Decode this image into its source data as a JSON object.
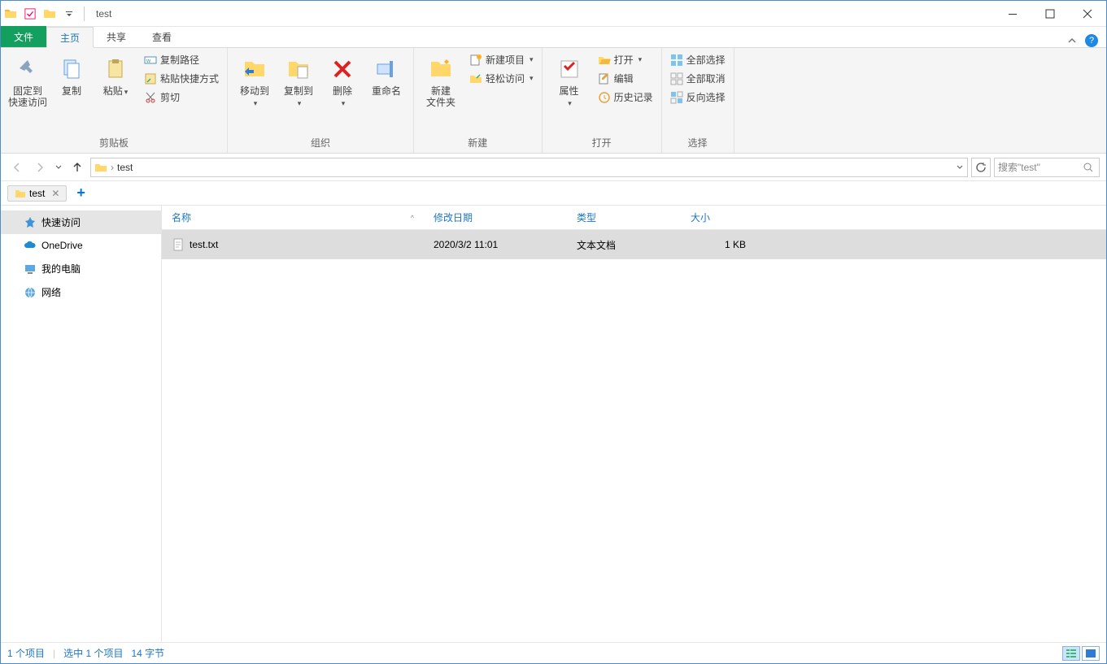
{
  "title": "test",
  "menutabs": {
    "file": "文件",
    "home": "主页",
    "share": "共享",
    "view": "查看"
  },
  "ribbon": {
    "clipboard": {
      "pin": "固定到\n快速访问",
      "copy": "复制",
      "paste": "粘贴",
      "copypath": "复制路径",
      "pasteshortcut": "粘贴快捷方式",
      "cut": "剪切",
      "label": "剪贴板"
    },
    "organize": {
      "moveto": "移动到",
      "copyto": "复制到",
      "delete": "删除",
      "rename": "重命名",
      "label": "组织"
    },
    "new": {
      "newfolder": "新建\n文件夹",
      "newitem": "新建项目",
      "easyaccess": "轻松访问",
      "label": "新建"
    },
    "open": {
      "properties": "属性",
      "open": "打开",
      "edit": "编辑",
      "history": "历史记录",
      "label": "打开"
    },
    "select": {
      "selectall": "全部选择",
      "selectnone": "全部取消",
      "invert": "反向选择",
      "label": "选择"
    }
  },
  "crumb": "test",
  "search_placeholder": "搜索\"test\"",
  "tab": {
    "name": "test"
  },
  "sidebar": {
    "items": [
      {
        "label": "快速访问"
      },
      {
        "label": "OneDrive"
      },
      {
        "label": "我的电脑"
      },
      {
        "label": "网络"
      }
    ]
  },
  "columns": {
    "name": "名称",
    "date": "修改日期",
    "type": "类型",
    "size": "大小"
  },
  "files": [
    {
      "name": "test.txt",
      "date": "2020/3/2 11:01",
      "type": "文本文档",
      "size": "1 KB"
    }
  ],
  "status": {
    "items": "1 个项目",
    "selected": "选中 1 个项目",
    "bytes": "14 字节"
  }
}
